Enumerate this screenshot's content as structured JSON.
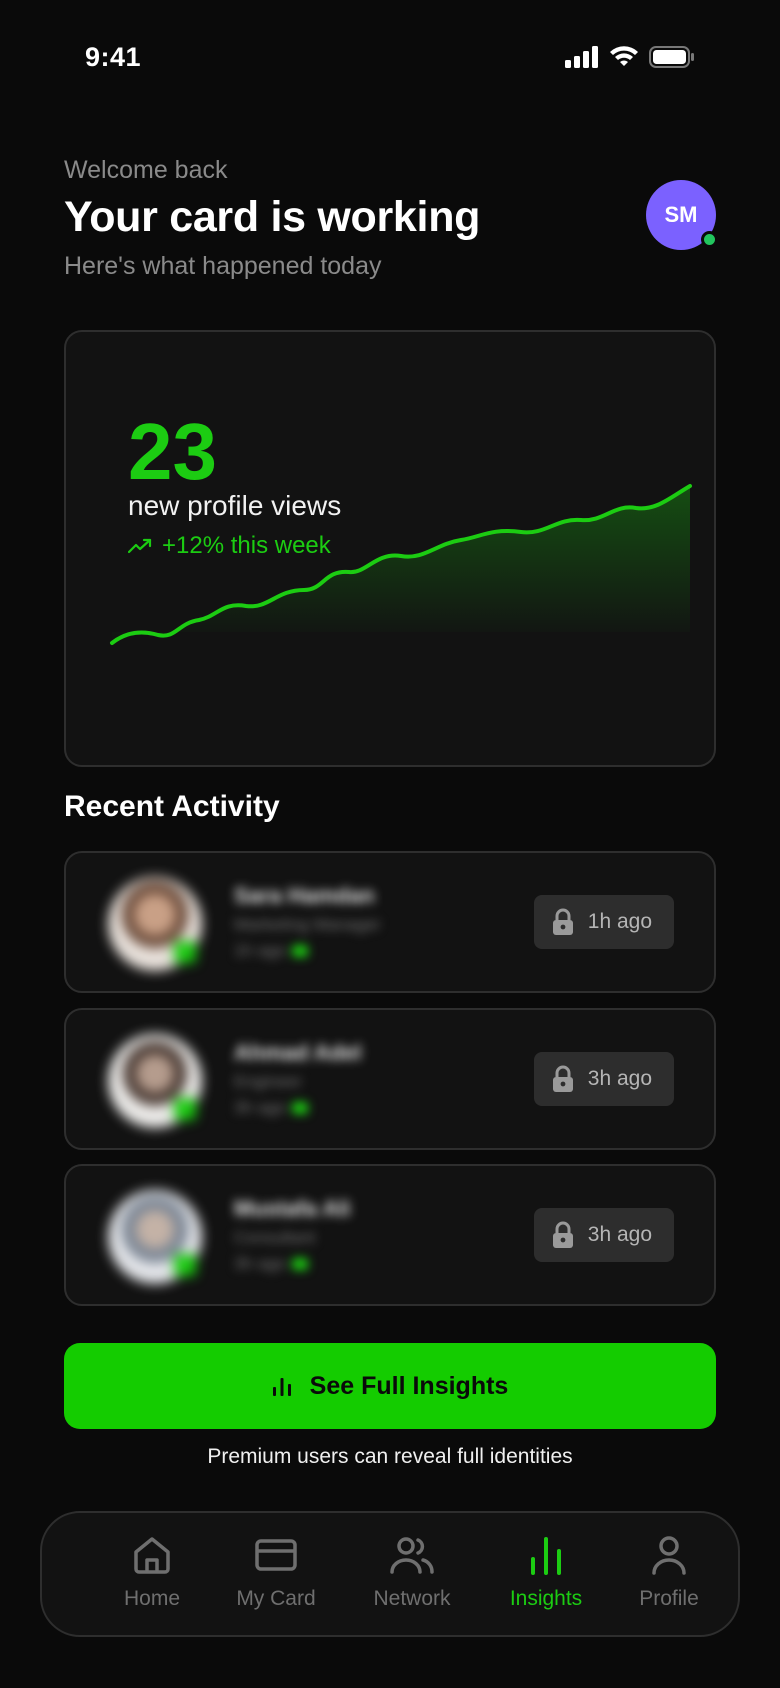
{
  "status_bar": {
    "time": "9:41"
  },
  "header": {
    "welcome": "Welcome back",
    "headline": "Your card is working",
    "subline": "Here's what happened today",
    "avatar_initials": "SM"
  },
  "views": {
    "count": "23",
    "label": "new profile views",
    "trend": "+12% this week",
    "accent_color": "#1ccc12"
  },
  "recent_activity": {
    "title": "Recent Activity",
    "items": [
      {
        "name": "Sara Hamdan",
        "role": "Marketing Manager",
        "ago": "1h ago",
        "time": "1h ago",
        "avatar_tone": "#b08a72"
      },
      {
        "name": "Ahmad Adel",
        "role": "Engineer",
        "ago": "3h ago",
        "time": "3h ago",
        "avatar_tone": "#8c7b70"
      },
      {
        "name": "Mustafa Ali",
        "role": "Consultant",
        "ago": "3h ago",
        "time": "3h ago",
        "avatar_tone": "#9aa1aa"
      }
    ]
  },
  "cta": {
    "label": "See Full Insights",
    "note": "Premium users can reveal full identities"
  },
  "nav": {
    "items": [
      {
        "label": "Home",
        "icon": "home-icon",
        "active": false
      },
      {
        "label": "My Card",
        "icon": "card-icon",
        "active": false
      },
      {
        "label": "Network",
        "icon": "users-icon",
        "active": false
      },
      {
        "label": "Insights",
        "icon": "bar-chart-icon",
        "active": true
      },
      {
        "label": "Profile",
        "icon": "user-icon",
        "active": false
      }
    ]
  }
}
